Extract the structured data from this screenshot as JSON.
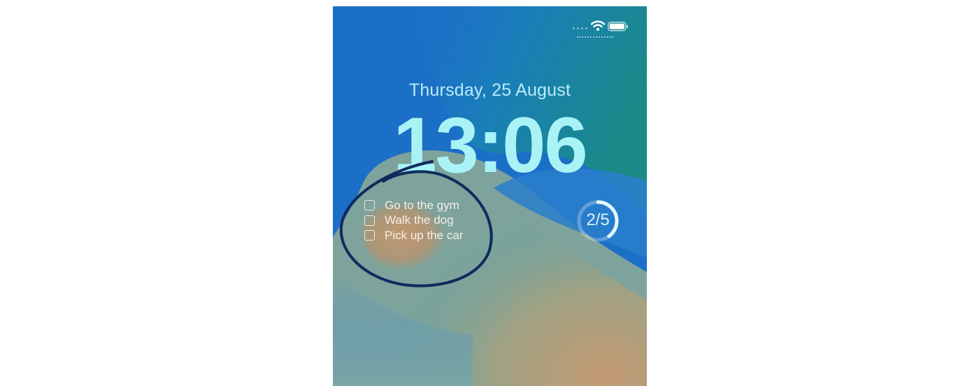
{
  "lock_screen": {
    "date": "Thursday, 25 August",
    "time": "13:06"
  },
  "status_bar": {
    "icons": [
      "cellular-signal-icon",
      "wifi-icon",
      "battery-icon"
    ]
  },
  "reminders_widget": {
    "items": [
      {
        "label": "Go to the gym",
        "checked": false
      },
      {
        "label": "Walk the dog",
        "checked": false
      },
      {
        "label": "Pick up the car",
        "checked": false
      }
    ]
  },
  "progress_widget": {
    "label": "2/5",
    "completed": 2,
    "total": 5
  },
  "annotation": {
    "type": "hand-drawn-circle",
    "color": "#0f2a5e"
  },
  "colors": {
    "wallpaper_blue": "#1c6fc6",
    "wallpaper_teal": "#1d8f8a",
    "wallpaper_tan": "#c39a72",
    "clock_text": "#a9f3f7"
  }
}
